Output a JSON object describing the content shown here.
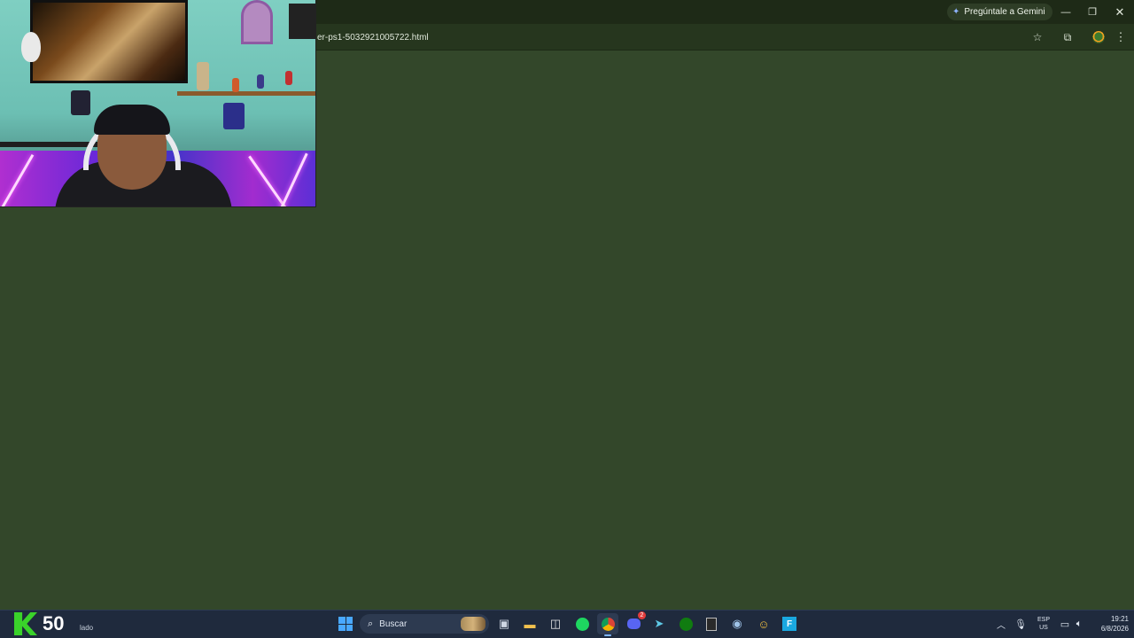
{
  "browser": {
    "url": "er-ps1-5032921005722.html",
    "gemini_label": "Pregúntale a Gemini",
    "icons": {
      "gemini": "sparkle-icon",
      "minimize": "minimize-icon",
      "maximize": "restore-icon",
      "close": "close-icon",
      "bookmark": "star-icon",
      "extensions": "puzzle-icon",
      "profile": "avatar-icon",
      "menu": "kebab-menu-icon"
    },
    "colors": {
      "page_bg": "#33472a",
      "titlebar": "#1e2a17",
      "toolbar": "#26361e"
    }
  },
  "webcam": {
    "description_icon": "webcam-overlay"
  },
  "taskbar": {
    "widget": {
      "number": "50",
      "subtext": "lado"
    },
    "search_label": "Buscar",
    "apps": [
      {
        "name": "start-button",
        "icon": "windows-icon"
      },
      {
        "name": "task-view",
        "icon": "task-view-icon"
      },
      {
        "name": "file-explorer",
        "icon": "folder-icon"
      },
      {
        "name": "microsoft-store",
        "icon": "store-icon"
      },
      {
        "name": "spotify",
        "icon": "spotify-icon"
      },
      {
        "name": "chrome",
        "icon": "chrome-icon"
      },
      {
        "name": "discord",
        "icon": "discord-icon",
        "badge": "2"
      },
      {
        "name": "app-arrow",
        "icon": "arrow-app-icon"
      },
      {
        "name": "xbox",
        "icon": "xbox-icon"
      },
      {
        "name": "epic-games",
        "icon": "epic-icon"
      },
      {
        "name": "steam",
        "icon": "steam-icon"
      },
      {
        "name": "app-character",
        "icon": "character-app-icon"
      },
      {
        "name": "app-f",
        "icon": "f-app-icon"
      }
    ],
    "tray": {
      "lang_top": "ESP",
      "lang_bottom": "US",
      "time": "19:21",
      "date": "6/8/2026"
    }
  }
}
